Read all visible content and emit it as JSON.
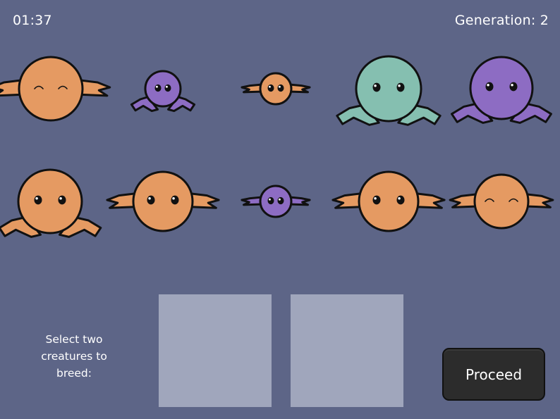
{
  "hud": {
    "timer": "01:37",
    "generation": "Generation: 2"
  },
  "selection": {
    "prompt_line1": "Select two",
    "prompt_line2": "creatures to",
    "prompt_line3": "breed:"
  },
  "controls": {
    "proceed_label": "Proceed"
  },
  "colors": {
    "background": "#5d6587",
    "orange": "#e59a62",
    "purple": "#8d6cc3",
    "teal": "#85bfb0",
    "slot": "#a0a6bc",
    "button": "#2c2c2c"
  },
  "creatures": [
    {
      "color": "orange",
      "eyes": "closed",
      "limbs": "ears"
    },
    {
      "color": "purple",
      "eyes": "open",
      "limbs": "legs"
    },
    {
      "color": "orange",
      "eyes": "open",
      "limbs": "ears"
    },
    {
      "color": "teal",
      "eyes": "open",
      "limbs": "legs"
    },
    {
      "color": "purple",
      "eyes": "open",
      "limbs": "legs"
    },
    {
      "color": "orange",
      "eyes": "open",
      "limbs": "legs"
    },
    {
      "color": "orange",
      "eyes": "open",
      "limbs": "ears"
    },
    {
      "color": "purple",
      "eyes": "open",
      "limbs": "ears"
    },
    {
      "color": "orange",
      "eyes": "open",
      "limbs": "ears"
    },
    {
      "color": "orange",
      "eyes": "closed",
      "limbs": "ears"
    }
  ]
}
